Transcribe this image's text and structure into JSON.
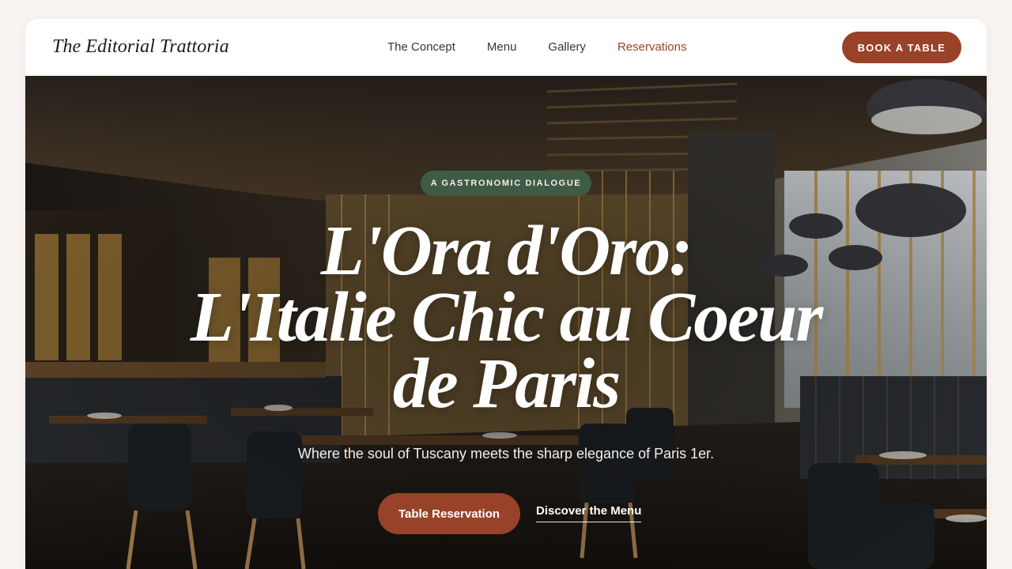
{
  "brand": {
    "name": "The Editorial Trattoria"
  },
  "nav": {
    "links": [
      {
        "label": "The Concept"
      },
      {
        "label": "Menu"
      },
      {
        "label": "Gallery"
      },
      {
        "label": "Reservations",
        "active": true
      }
    ],
    "cta": "BOOK A TABLE"
  },
  "hero": {
    "tag": "A GASTRONOMIC DIALOGUE",
    "headline": [
      "L'Ora d'Oro:",
      "L'Italie Chic au Coeur",
      "de Paris"
    ],
    "subtitle": "Where the soul of Tuscany meets the sharp elegance of Paris 1er.",
    "primary_cta": "Table Reservation",
    "secondary_cta": "Discover the Menu",
    "image_description": "restaurant-interior-photo"
  },
  "colors": {
    "accent": "#984229",
    "tag_bg": "#3f5a45",
    "page_bg": "#f8f4f1",
    "text_dark": "#1f1a17"
  }
}
